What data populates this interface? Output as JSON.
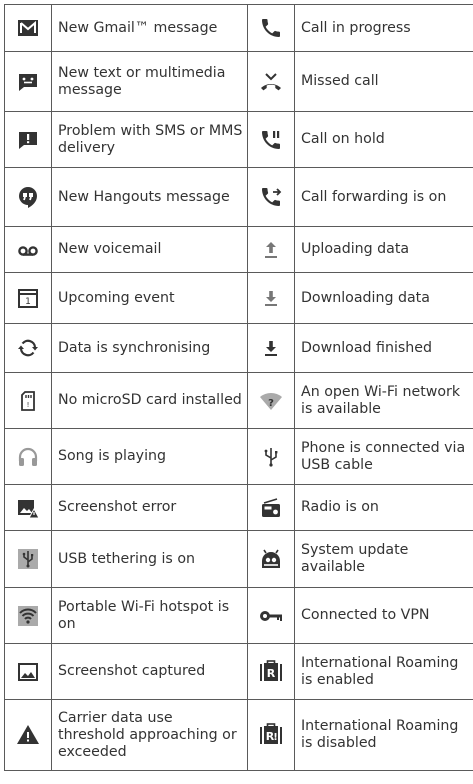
{
  "rows": [
    {
      "l_icon": "gmail-envelope-icon",
      "l_text": "New Gmail™ message",
      "r_icon": "phone-call-icon",
      "r_text": "Call in progress"
    },
    {
      "l_icon": "chat-message-icon",
      "l_text": "New text or multimedia message",
      "r_icon": "missed-call-icon",
      "r_text": "Missed call"
    },
    {
      "l_icon": "sms-problem-icon",
      "l_text": "Problem with SMS or MMS delivery",
      "r_icon": "call-on-hold-icon",
      "r_text": "Call on hold"
    },
    {
      "l_icon": "hangouts-icon",
      "l_text": "New Hangouts message",
      "r_icon": "call-forwarding-icon",
      "r_text": "Call forwarding is on"
    },
    {
      "l_icon": "voicemail-icon",
      "l_text": "New voicemail",
      "r_icon": "upload-icon",
      "r_text": "Uploading data"
    },
    {
      "l_icon": "calendar-event-icon",
      "l_text": "Upcoming event",
      "r_icon": "download-icon",
      "r_text": "Downloading data"
    },
    {
      "l_icon": "sync-icon",
      "l_text": "Data is synchronising",
      "r_icon": "download-finished-icon",
      "r_text": "Download finished"
    },
    {
      "l_icon": "no-sd-card-icon",
      "l_text": "No microSD card installed",
      "r_icon": "open-wifi-icon",
      "r_text": "An open Wi-Fi network is available"
    },
    {
      "l_icon": "headphones-icon",
      "l_text": "Song is playing",
      "r_icon": "usb-icon",
      "r_text": "Phone is connected via USB cable"
    },
    {
      "l_icon": "screenshot-error-icon",
      "l_text": "Screenshot error",
      "r_icon": "radio-icon",
      "r_text": "Radio is on"
    },
    {
      "l_icon": "usb-tethering-icon",
      "l_text": "USB tethering is on",
      "r_icon": "system-update-icon",
      "r_text": "System update available"
    },
    {
      "l_icon": "wifi-hotspot-icon",
      "l_text": "Portable Wi-Fi hotspot is on",
      "r_icon": "vpn-key-icon",
      "r_text": "Connected to VPN"
    },
    {
      "l_icon": "screenshot-captured-icon",
      "l_text": "Screenshot captured",
      "r_icon": "roaming-enabled-icon",
      "r_text": "International Roaming is enabled"
    },
    {
      "l_icon": "warning-triangle-icon",
      "l_text": "Carrier data use threshold approaching or exceeded",
      "r_icon": "roaming-disabled-icon",
      "r_text": "International Roaming is disabled"
    }
  ]
}
